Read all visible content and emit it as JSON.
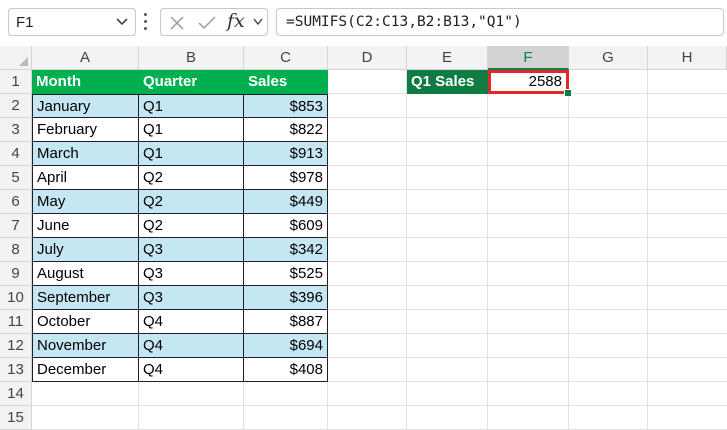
{
  "formula_bar": {
    "name_box": "F1",
    "formula": "=SUMIFS(C2:C13,B2:B13,\"Q1\")",
    "fx_label": "fx"
  },
  "columns": [
    "A",
    "B",
    "C",
    "D",
    "E",
    "F",
    "G",
    "H"
  ],
  "active_column": "F",
  "rows": [
    "1",
    "2",
    "3",
    "4",
    "5",
    "6",
    "7",
    "8",
    "9",
    "10",
    "11",
    "12",
    "13",
    "14",
    "15"
  ],
  "table": {
    "headers": [
      "Month",
      "Quarter",
      "Sales"
    ],
    "rows": [
      {
        "month": "January",
        "quarter": "Q1",
        "sales": "$853"
      },
      {
        "month": "February",
        "quarter": "Q1",
        "sales": "$822"
      },
      {
        "month": "March",
        "quarter": "Q1",
        "sales": "$913"
      },
      {
        "month": "April",
        "quarter": "Q2",
        "sales": "$978"
      },
      {
        "month": "May",
        "quarter": "Q2",
        "sales": "$449"
      },
      {
        "month": "June",
        "quarter": "Q2",
        "sales": "$609"
      },
      {
        "month": "July",
        "quarter": "Q3",
        "sales": "$342"
      },
      {
        "month": "August",
        "quarter": "Q3",
        "sales": "$525"
      },
      {
        "month": "September",
        "quarter": "Q3",
        "sales": "$396"
      },
      {
        "month": "October",
        "quarter": "Q4",
        "sales": "$887"
      },
      {
        "month": "November",
        "quarter": "Q4",
        "sales": "$694"
      },
      {
        "month": "December",
        "quarter": "Q4",
        "sales": "$408"
      }
    ]
  },
  "summary": {
    "label": "Q1 Sales",
    "value": "2588"
  },
  "colors": {
    "header_green": "#00b050",
    "label_green": "#107c41",
    "band_blue": "#c5e6f3",
    "highlight_red": "#e1262c"
  }
}
